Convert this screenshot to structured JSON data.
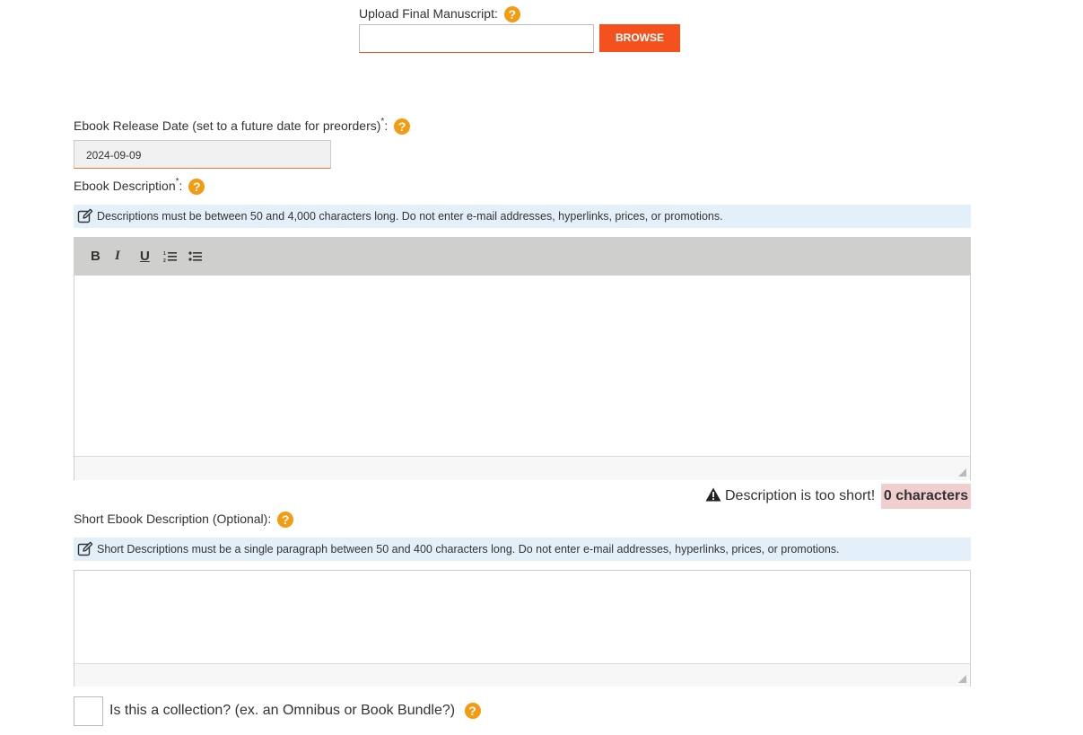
{
  "manuscript": {
    "label": "Upload Final Manuscript:",
    "file_value": "",
    "browse_label": "BROWSE"
  },
  "release_date": {
    "label": "Ebook Release Date (set to a future date for preorders)",
    "required_mark": "*",
    "colon": ":",
    "value": "2024-09-09"
  },
  "description": {
    "label": "Ebook Description",
    "required_mark": "*",
    "colon": ":",
    "info": "Descriptions must be between 50 and 4,000 characters long. Do not enter e-mail addresses, hyperlinks, prices, or promotions.",
    "toolbar": {
      "bold": "B",
      "italic": "I",
      "underline": "U"
    },
    "warning": "Description is too short!",
    "char_count": "0 characters"
  },
  "short_description": {
    "label": "Short Ebook Description (Optional):",
    "info": "Short Descriptions must be a single paragraph between 50 and 400 characters long. Do not enter e-mail addresses, hyperlinks, prices, or promotions."
  },
  "collection": {
    "label": "Is this a collection? (ex. an Omnibus or Book Bundle?)",
    "checked": false
  },
  "help_glyph": "?",
  "colors": {
    "accent": "#f4511e",
    "help": "#f39c12",
    "info_bg": "#e3f0fa",
    "warning_bg": "#f2cfcf",
    "toolbar_bg": "#cfcfcd"
  }
}
